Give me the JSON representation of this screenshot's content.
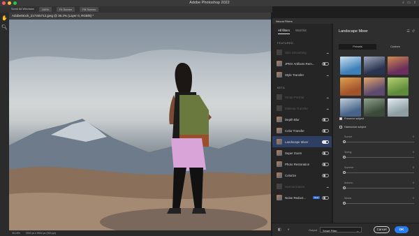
{
  "window": {
    "title": "Adobe Photoshop 2022"
  },
  "options_bar": {
    "items": [
      "Scroll All Windows",
      "100%",
      "Fit Screen",
      "Fill Screen"
    ]
  },
  "document": {
    "tab_label": "AdobeStock_217345712.jpeg @ 36.2% (Layer 0, RGB/8) *"
  },
  "status": {
    "zoom": "36.18%",
    "info": "3992 px x 5504 px (300 ppi)"
  },
  "neural_filters": {
    "panel_title": "Neural Filters",
    "tabs": [
      "All filters",
      "Wait list"
    ],
    "featured_label": "FEATURED",
    "featured": [
      {
        "label": "Skin Smoothing",
        "state": "dim"
      },
      {
        "label": "JPEG Artifacts Rem...",
        "state": "off"
      },
      {
        "label": "Style Transfer",
        "state": "cloud"
      }
    ],
    "beta_label": "BETA",
    "beta": [
      {
        "label": "Smart Portrait",
        "state": "dim"
      },
      {
        "label": "Makeup Transfer",
        "state": "dim"
      },
      {
        "label": "Depth Blur",
        "state": "off"
      },
      {
        "label": "Color Transfer",
        "state": "off"
      },
      {
        "label": "Landscape Mixer",
        "state": "on"
      },
      {
        "label": "Super Zoom",
        "state": "off"
      },
      {
        "label": "Photo Restoration",
        "state": "off"
      },
      {
        "label": "Colorize",
        "state": "off"
      },
      {
        "label": "Harmonization",
        "state": "dim"
      },
      {
        "label": "Noise Reduct...",
        "state": "new"
      }
    ],
    "new_badge": "New"
  },
  "detail": {
    "title": "Landscape Mixer",
    "segments": [
      "Presets",
      "Custom"
    ],
    "active_segment": "Presets",
    "preserve_subject": {
      "label": "Preserve subject",
      "checked": true
    },
    "harmonize_subject": {
      "label": "Harmonize subject",
      "checked": false
    },
    "sliders": [
      {
        "label": "Sunset",
        "value": "0"
      },
      {
        "label": "Spring",
        "value": "0"
      },
      {
        "label": "Summer",
        "value": "0"
      },
      {
        "label": "Autumn",
        "value": "0"
      },
      {
        "label": "Winter",
        "value": "0"
      }
    ],
    "preset_colors": [
      [
        "#3d7fb8",
        "#cde3f2"
      ],
      [
        "#2a3450",
        "#a0a8bc"
      ],
      [
        "#6a2f5c",
        "#d28a4e"
      ],
      [
        "#a3532b",
        "#e0a04f"
      ],
      [
        "#5d4a6e",
        "#e3a46a"
      ],
      [
        "#5f8c3a",
        "#b7cf74"
      ],
      [
        "#47638a",
        "#c1cfdc"
      ],
      [
        "#3b4a3a",
        "#8fa38c"
      ],
      [
        "#8e9ea3",
        "#e2ecef"
      ]
    ]
  },
  "footer": {
    "output_label": "Output",
    "output_value": "Smart Filter",
    "cancel": "Cancel",
    "ok": "OK"
  }
}
